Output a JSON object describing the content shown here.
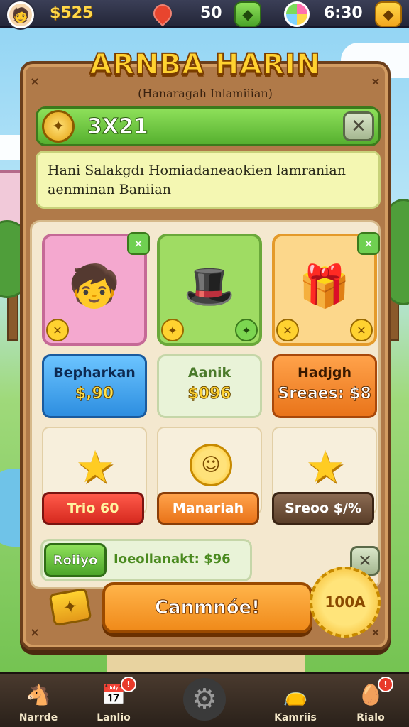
{
  "topbar": {
    "coins": "$525",
    "lives": "50",
    "timer": "6:30",
    "gem_symbol": "◆",
    "ticket_symbol": "◆"
  },
  "panel": {
    "title": "ARNBA HARIN",
    "subtitle": "(Hanaragah Inlamiiian)",
    "score": "3X21",
    "message": "Hani Salakgdı Homiadaneaokien lamranian aenminan Baniian"
  },
  "cards": [
    {
      "name": "character",
      "art": "🧒",
      "theme": "pink"
    },
    {
      "name": "hat-machine",
      "art": "🎩",
      "theme": "green"
    },
    {
      "name": "gift-box",
      "art": "🎁",
      "theme": "gold"
    }
  ],
  "prices": [
    {
      "label": "Bepharkan",
      "value": "$,90"
    },
    {
      "label": "Aanik",
      "value": "$096"
    },
    {
      "label": "Hadjgh",
      "value": "Sreaes: $8"
    }
  ],
  "rewards": [
    {
      "icon": "star-icon",
      "button": "Trio 60"
    },
    {
      "icon": "sun-icon",
      "button": "Manariah"
    },
    {
      "icon": "star-icon",
      "button": "Sreoo $/%"
    }
  ],
  "promo": {
    "tag": "Roiiyo",
    "text": "Ioeollanakt: $96"
  },
  "confirm": {
    "label": "Canmnóe!",
    "badge": "100A"
  },
  "nav": [
    {
      "label": "Narrde",
      "icon": "🐴",
      "badge": ""
    },
    {
      "label": "Lanlio",
      "icon": "📅",
      "badge": "!"
    },
    {
      "label": "",
      "icon": "⚙",
      "badge": ""
    },
    {
      "label": "Kamriis",
      "icon": "👝",
      "badge": ""
    },
    {
      "label": "Rialo",
      "icon": "🥚",
      "badge": "!"
    }
  ],
  "colors": {
    "panel_wood": "#b07a49",
    "score_green": "#56b02f",
    "confirm_orange": "#f08a1a",
    "gold": "#ffd230"
  }
}
